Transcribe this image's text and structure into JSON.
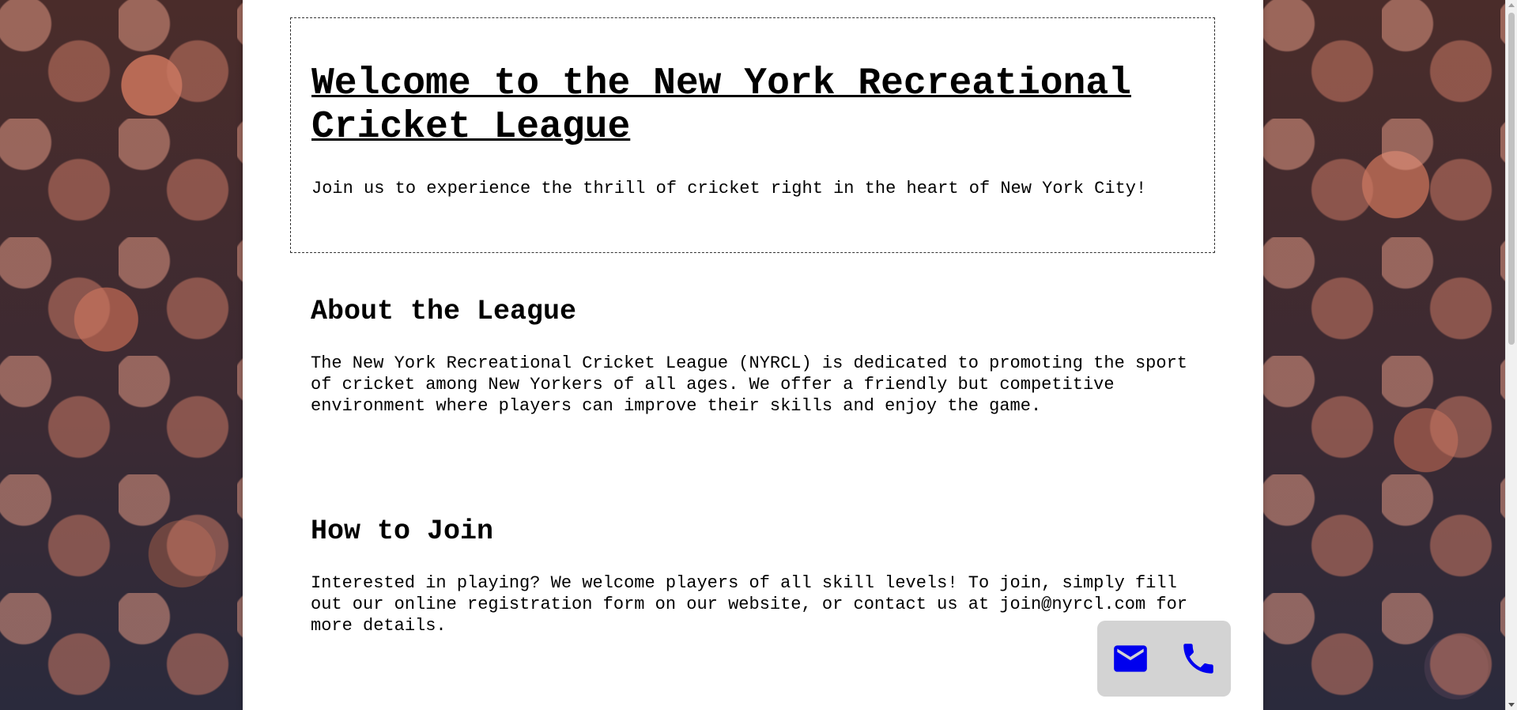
{
  "hero": {
    "title": "Welcome to the New York Recreational Cricket League",
    "tagline": "Join us to experience the thrill of cricket right in the heart of New York City!"
  },
  "about": {
    "heading": "About the League",
    "body": "The New York Recreational Cricket League (NYRCL) is dedicated to promoting the sport of cricket among New Yorkers of all ages. We offer a friendly but competitive environment where players can improve their skills and enjoy the game."
  },
  "join": {
    "heading": "How to Join",
    "body": "Interested in playing? We welcome players of all skill levels! To join, simply fill out our online registration form on our website, or contact us at join@nyrcl.com for more details."
  },
  "contact": {
    "icons": [
      "mail-icon",
      "phone-icon"
    ],
    "icon_color": "#0000ee",
    "panel_color": "#d3d3d3"
  },
  "colors": {
    "page_background": "#ffffff",
    "text": "#000000"
  }
}
